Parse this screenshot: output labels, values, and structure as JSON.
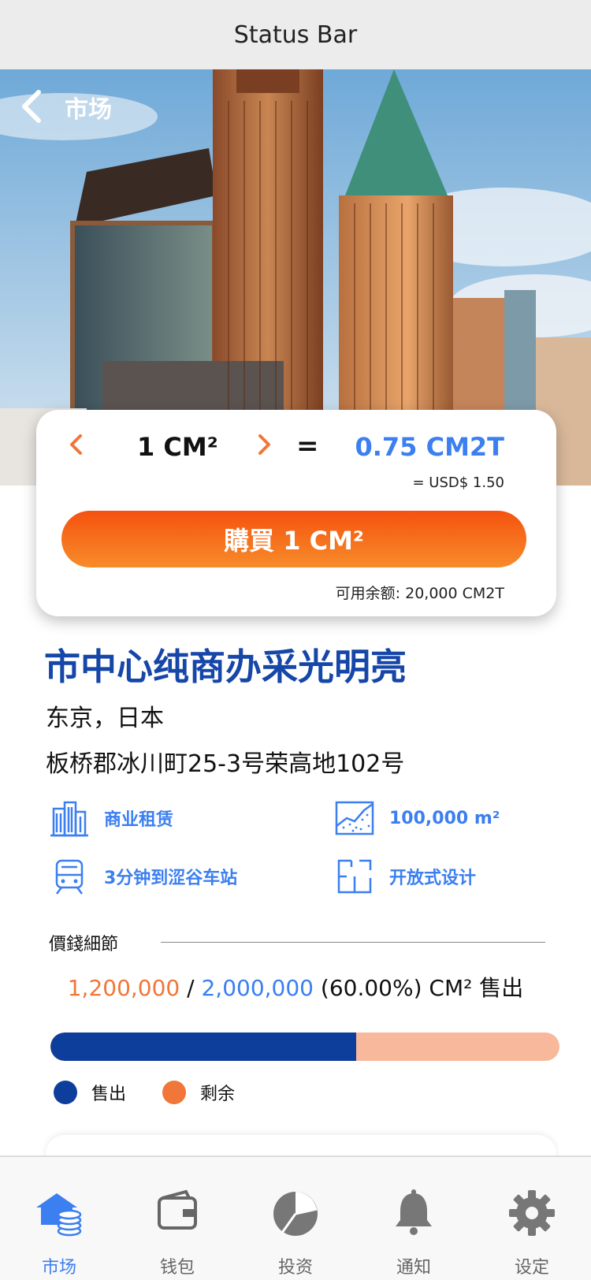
{
  "status_bar": {
    "label": "Status Bar"
  },
  "nav": {
    "back_icon": "chevron-left-icon",
    "title": "市场"
  },
  "price_card": {
    "prev_icon": "chevron-left-icon",
    "quantity": "1 CM²",
    "next_icon": "chevron-right-icon",
    "equals": "=",
    "token_value": "0.75 CM2T",
    "usd_value": "= USD$  1.50",
    "buy_label": "購買 1 CM²",
    "balance": "可用余额: 20,000 CM2T"
  },
  "property": {
    "title": "市中心纯商办采光明亮",
    "city": "东京，日本",
    "address": "板桥郡冰川町25-3号荣高地102号"
  },
  "features": [
    {
      "icon": "buildings-icon",
      "label": "商业租赁"
    },
    {
      "icon": "area-chart-icon",
      "label": "100,000 m²"
    },
    {
      "icon": "train-icon",
      "label": "3分钟到涩谷车站"
    },
    {
      "icon": "floor-plan-icon",
      "label": "开放式设计"
    }
  ],
  "price_details": {
    "section_label": "價錢細節",
    "sold": "1,200,000",
    "separator": " / ",
    "total": "2,000,000",
    "suffix": " (60.00%) CM² 售出",
    "progress_fraction": 0.6,
    "legend": [
      {
        "label": "售出",
        "color": "#0e3e9c"
      },
      {
        "label": "剩余",
        "color": "#f0763a"
      }
    ]
  },
  "tabs": [
    {
      "label": "市场",
      "icon": "market-house-coins-icon",
      "active": true
    },
    {
      "label": "钱包",
      "icon": "wallet-icon",
      "active": false
    },
    {
      "label": "投资",
      "icon": "pie-chart-icon",
      "active": false
    },
    {
      "label": "通知",
      "icon": "bell-icon",
      "active": false
    },
    {
      "label": "设定",
      "icon": "gear-icon",
      "active": false
    }
  ],
  "colors": {
    "accent_blue": "#3b7ff0",
    "navy": "#0e3e9c",
    "orange": "#f0763a"
  }
}
